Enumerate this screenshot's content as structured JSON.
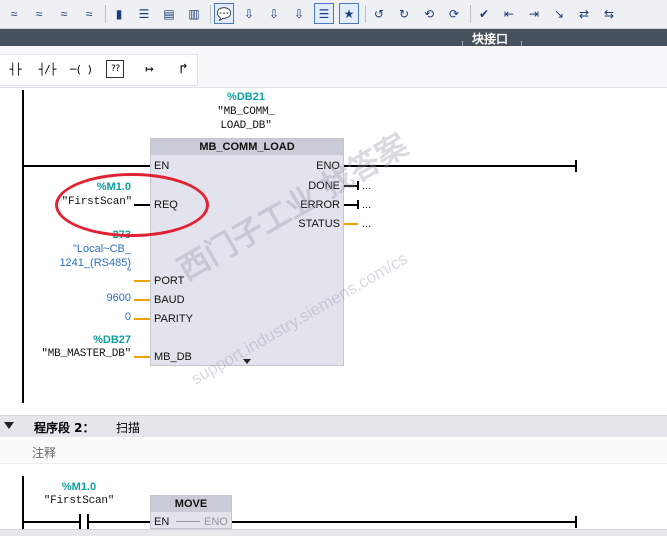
{
  "header": {
    "block_interface": "块接口"
  },
  "toolbar": {
    "buttons": [
      "≈",
      "≈",
      "≈",
      "≈",
      "▮",
      "☰",
      "▤",
      "▥",
      "💬",
      "⇩",
      "⇩",
      "⇩",
      "☰",
      "★",
      "↺",
      "↻",
      "⟲",
      "⟳",
      "✔",
      "⇤",
      "⇥",
      "↘",
      "⇄",
      "⇆"
    ]
  },
  "instructions": {
    "no_contact": "┤├",
    "nc_contact": "┤/├",
    "coil": "─( )",
    "empty_box": "??",
    "open_branch": "↦",
    "close_branch": "↱"
  },
  "network1": {
    "instance_db": "%DB21",
    "instance_db_name_1": "\"MB_COMM_",
    "instance_db_name_2": "LOAD_DB\"",
    "block_name": "MB_COMM_LOAD",
    "pins_in": [
      "EN",
      "REQ",
      "PORT",
      "BAUD",
      "PARITY",
      "MB_DB"
    ],
    "pins_out": [
      "ENO",
      "DONE",
      "ERROR",
      "STATUS"
    ],
    "out_ellipsis": "...",
    "req_address": "%M1.0",
    "req_symbol": "\"FirstScan\"",
    "port_value": "273",
    "port_symbol_1": "\"Local~CB_",
    "port_symbol_2": "1241_(RS485)",
    "port_symbol_3": "\"",
    "baud_value": "9600",
    "parity_value": "0",
    "mbdb_address": "%DB27",
    "mbdb_symbol": "\"MB_MASTER_DB\""
  },
  "network2": {
    "label": "程序段 2：",
    "title": "扫描",
    "comment": "注释",
    "contact_address": "%M1.0",
    "contact_symbol": "\"FirstScan\"",
    "block_name": "MOVE",
    "pin_en": "EN",
    "pin_eno": "ENO"
  },
  "watermark": {
    "line1": "西门子工业 找答案",
    "line2": "support.industry.siemens.com/cs"
  },
  "colors": {
    "highlight": "#e22233",
    "teal": "#10a0a0",
    "blue": "#2e6fb7",
    "wire": "#f0a100"
  }
}
